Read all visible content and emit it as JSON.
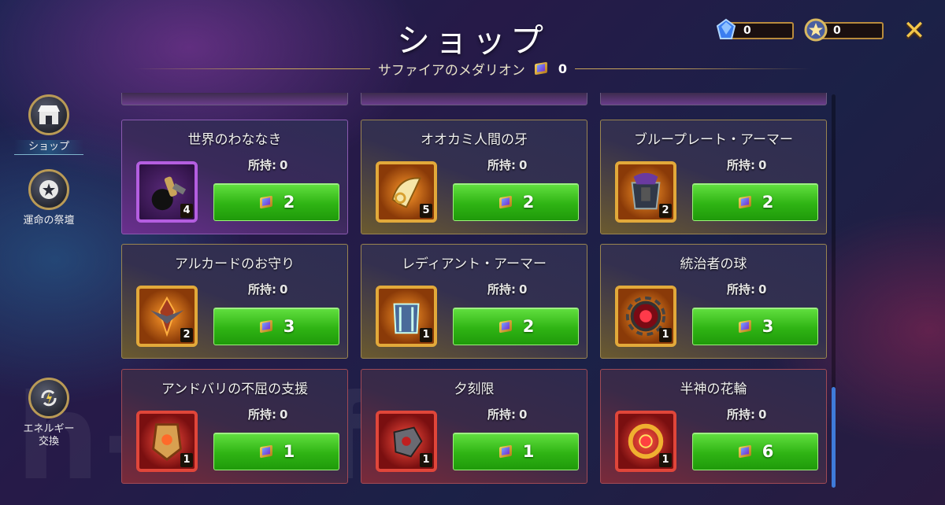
{
  "header": {
    "title": "ショップ",
    "subtitle": "サファイアのメダリオン",
    "subtitle_count": "0",
    "close_icon": "close-icon"
  },
  "currencies": [
    {
      "icon": "blue-crystal-icon",
      "value": "0",
      "color": "#4aa0ff"
    },
    {
      "icon": "star-medallion-icon",
      "value": "0",
      "color": "#c0a050"
    }
  ],
  "sidebar": {
    "items": [
      {
        "label": "ショップ",
        "icon": "shop-icon",
        "active": true
      },
      {
        "label": "運命の祭壇",
        "icon": "star-altar-icon",
        "active": false
      },
      {
        "label": "エネルギー\n交換",
        "icon": "energy-exchange-icon",
        "active": false
      }
    ]
  },
  "owned_label": "所持:",
  "items": [
    {
      "name": "世界のわななき",
      "owned": "0",
      "qty": "4",
      "price": "2",
      "rarity": "purple",
      "icon": "bomb-icon"
    },
    {
      "name": "オオカミ人間の牙",
      "owned": "0",
      "qty": "5",
      "price": "2",
      "rarity": "gold",
      "icon": "fang-icon"
    },
    {
      "name": "ブループレート・アーマー",
      "owned": "0",
      "qty": "2",
      "price": "2",
      "rarity": "gold",
      "icon": "armor-icon"
    },
    {
      "name": "アルカードのお守り",
      "owned": "0",
      "qty": "2",
      "price": "3",
      "rarity": "gold",
      "icon": "amulet-icon"
    },
    {
      "name": "レディアント・アーマー",
      "owned": "0",
      "qty": "1",
      "price": "2",
      "rarity": "gold",
      "icon": "chest-armor-icon"
    },
    {
      "name": "統治者の球",
      "owned": "0",
      "qty": "1",
      "price": "3",
      "rarity": "gold",
      "icon": "orb-icon"
    },
    {
      "name": "アンドバリの不屈の支援",
      "owned": "0",
      "qty": "1",
      "price": "1",
      "rarity": "red",
      "icon": "shield-icon"
    },
    {
      "name": "夕刻限",
      "owned": "0",
      "qty": "1",
      "price": "1",
      "rarity": "red",
      "icon": "gauntlet-icon"
    },
    {
      "name": "半神の花輪",
      "owned": "0",
      "qty": "1",
      "price": "6",
      "rarity": "red",
      "icon": "wreath-icon"
    }
  ]
}
